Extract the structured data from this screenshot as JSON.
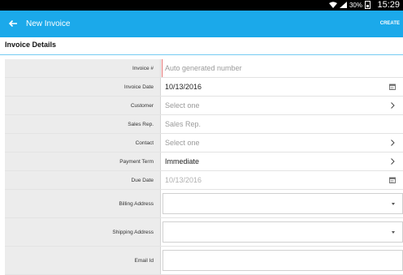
{
  "status_bar": {
    "time": "15:29",
    "battery_percent": "30%"
  },
  "app_bar": {
    "title": "New Invoice",
    "action": "CREATE"
  },
  "section": {
    "title": "Invoice Details"
  },
  "fields": [
    {
      "label": "Invoice #",
      "value": "Auto generated number",
      "state": "placeholder"
    },
    {
      "label": "Invoice Date",
      "value": "10/13/2016",
      "state": "value"
    },
    {
      "label": "Customer",
      "value": "Select one",
      "state": "placeholder"
    },
    {
      "label": "Sales Rep.",
      "value": "Sales Rep.",
      "state": "placeholder"
    },
    {
      "label": "Contact",
      "value": "Select one",
      "state": "placeholder"
    },
    {
      "label": "Payment Term",
      "value": "Immediate",
      "state": "value"
    },
    {
      "label": "Due Date",
      "value": "10/13/2016",
      "state": "disabled"
    },
    {
      "label": "Billing Address",
      "value": "",
      "state": "dropdown"
    },
    {
      "label": "Shipping Address",
      "value": "",
      "state": "dropdown"
    },
    {
      "label": "Email Id",
      "value": "",
      "state": "empty"
    }
  ],
  "icons": {
    "back": "arrow-left-icon",
    "calendar": "calendar-icon",
    "chevron": "chevron-right-icon",
    "dropdown": "dropdown-arrow-icon"
  },
  "colors": {
    "accent": "#1ba9ea",
    "label_bg": "#ececec"
  }
}
